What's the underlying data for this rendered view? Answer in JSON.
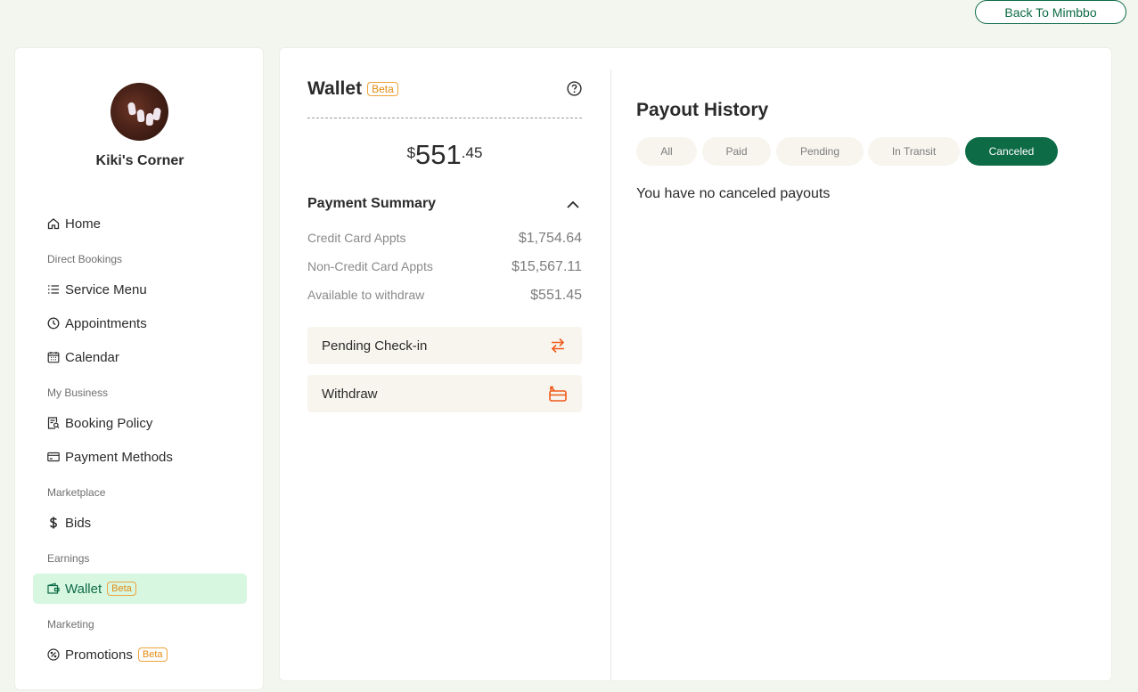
{
  "header": {
    "back_label": "Back To Mimbbo"
  },
  "profile": {
    "name": "Kiki's Corner"
  },
  "sidebar": {
    "home": "Home",
    "sec_direct": "Direct Bookings",
    "service_menu": "Service Menu",
    "appointments": "Appointments",
    "calendar": "Calendar",
    "sec_business": "My Business",
    "booking_policy": "Booking Policy",
    "payment_methods": "Payment Methods",
    "sec_marketplace": "Marketplace",
    "bids": "Bids",
    "sec_earnings": "Earnings",
    "wallet": "Wallet",
    "wallet_badge": "Beta",
    "sec_marketing": "Marketing",
    "promotions": "Promotions",
    "promotions_badge": "Beta"
  },
  "wallet": {
    "title": "Wallet",
    "badge": "Beta",
    "currency": "$",
    "balance_whole": "551",
    "balance_cents": ".45",
    "summary_title": "Payment Summary",
    "rows": [
      {
        "label": "Credit Card Appts",
        "value": "$1,754.64"
      },
      {
        "label": "Non-Credit Card Appts",
        "value": "$15,567.11"
      },
      {
        "label": "Available to withdraw",
        "value": "$551.45"
      }
    ],
    "pending_label": "Pending Check-in",
    "withdraw_label": "Withdraw"
  },
  "payout": {
    "title": "Payout History",
    "tabs": [
      "All",
      "Paid",
      "Pending",
      "In Transit",
      "Canceled"
    ],
    "selected_tab": "Canceled",
    "empty_message": "You have no canceled payouts"
  },
  "colors": {
    "brand": "#0d6b46",
    "accent": "#f05a1a",
    "active_bg": "#d7f7e1",
    "badge": "#e58a12"
  }
}
